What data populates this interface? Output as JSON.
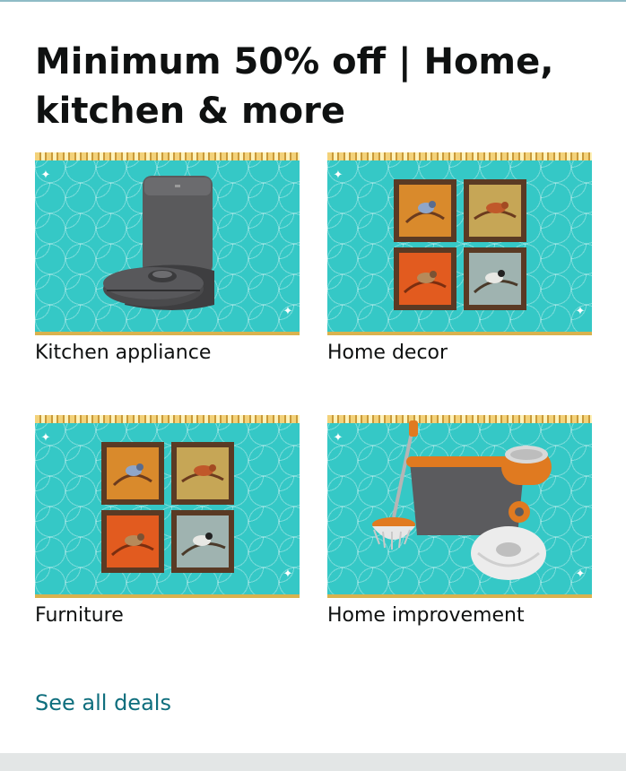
{
  "card": {
    "title": "Minimum 50% off | Home, kitchen & more",
    "tiles": [
      {
        "label": "Kitchen appliance",
        "image_icon": "robot-vacuum-icon"
      },
      {
        "label": "Home decor",
        "image_icon": "bird-paintings-icon"
      },
      {
        "label": "Furniture",
        "image_icon": "bird-paintings-icon"
      },
      {
        "label": "Home improvement",
        "image_icon": "spin-mop-bucket-icon"
      }
    ],
    "see_all_label": "See all deals"
  },
  "colors": {
    "tile_background": "#35c8c6",
    "link": "#0e6e7d",
    "text": "#0f1111",
    "bottom_bar": "#e3e6e6"
  }
}
